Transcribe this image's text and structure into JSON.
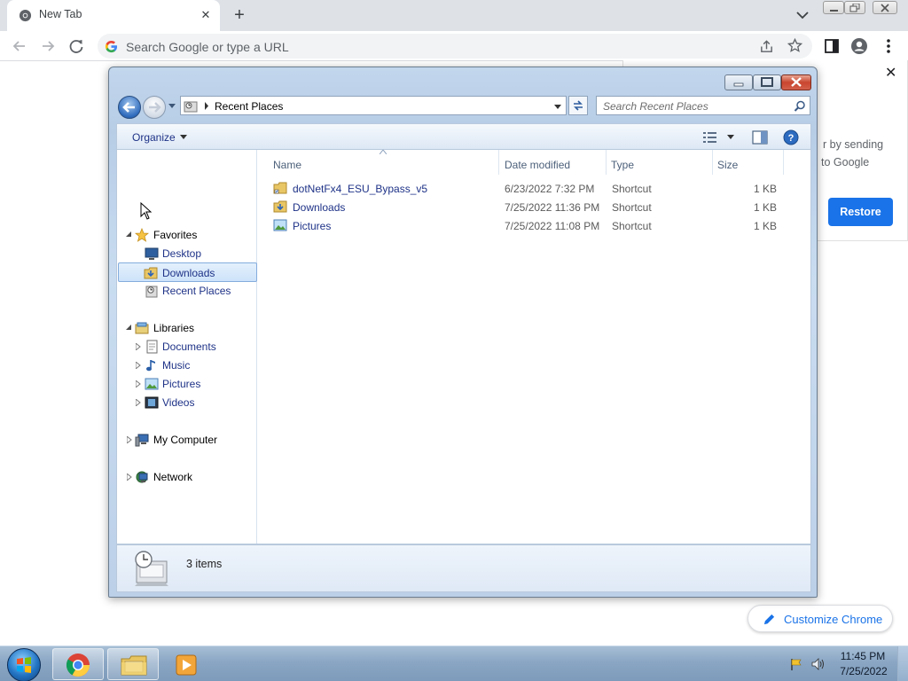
{
  "browser": {
    "tab_title": "New Tab",
    "tab_close_glyph": "✕",
    "new_tab_glyph": "+",
    "omnibox_placeholder": "Search Google or type a URL",
    "colors": {
      "tabbar": "#dee1e6",
      "accent": "#1a73e8"
    }
  },
  "ntp": {
    "close_glyph": "✕",
    "text_line1": "r by sending",
    "text_line2": "to Google",
    "restore_label": "Restore",
    "customize_label": "Customize Chrome"
  },
  "explorer": {
    "location": "Recent Places",
    "search_placeholder": "Search Recent Places",
    "organize_label": "Organize",
    "nav": {
      "favorites": {
        "label": "Favorites",
        "items": [
          {
            "label": "Desktop",
            "icon": "desktop-icon"
          },
          {
            "label": "Downloads",
            "icon": "downloads-folder-icon",
            "selected": true
          },
          {
            "label": "Recent Places",
            "icon": "recent-places-icon"
          }
        ]
      },
      "libraries": {
        "label": "Libraries",
        "items": [
          {
            "label": "Documents",
            "icon": "documents-icon"
          },
          {
            "label": "Music",
            "icon": "music-icon"
          },
          {
            "label": "Pictures",
            "icon": "pictures-icon"
          },
          {
            "label": "Videos",
            "icon": "videos-icon"
          }
        ]
      },
      "computer": {
        "label": "My Computer"
      },
      "network": {
        "label": "Network"
      }
    },
    "columns": [
      "Name",
      "Date modified",
      "Type",
      "Size"
    ],
    "files": [
      {
        "name": "dotNetFx4_ESU_Bypass_v5",
        "date": "6/23/2022 7:32 PM",
        "type": "Shortcut",
        "size": "1 KB",
        "icon": "folder-shortcut-icon"
      },
      {
        "name": "Downloads",
        "date": "7/25/2022 11:36 PM",
        "type": "Shortcut",
        "size": "1 KB",
        "icon": "downloads-shortcut-icon"
      },
      {
        "name": "Pictures",
        "date": "7/25/2022 11:08 PM",
        "type": "Shortcut",
        "size": "1 KB",
        "icon": "pictures-shortcut-icon"
      }
    ],
    "item_count": "3 items"
  },
  "taskbar": {
    "apps": [
      "chrome-icon",
      "explorer-icon",
      "media-player-icon"
    ],
    "clock_time": "11:45 PM",
    "clock_date": "7/25/2022"
  }
}
